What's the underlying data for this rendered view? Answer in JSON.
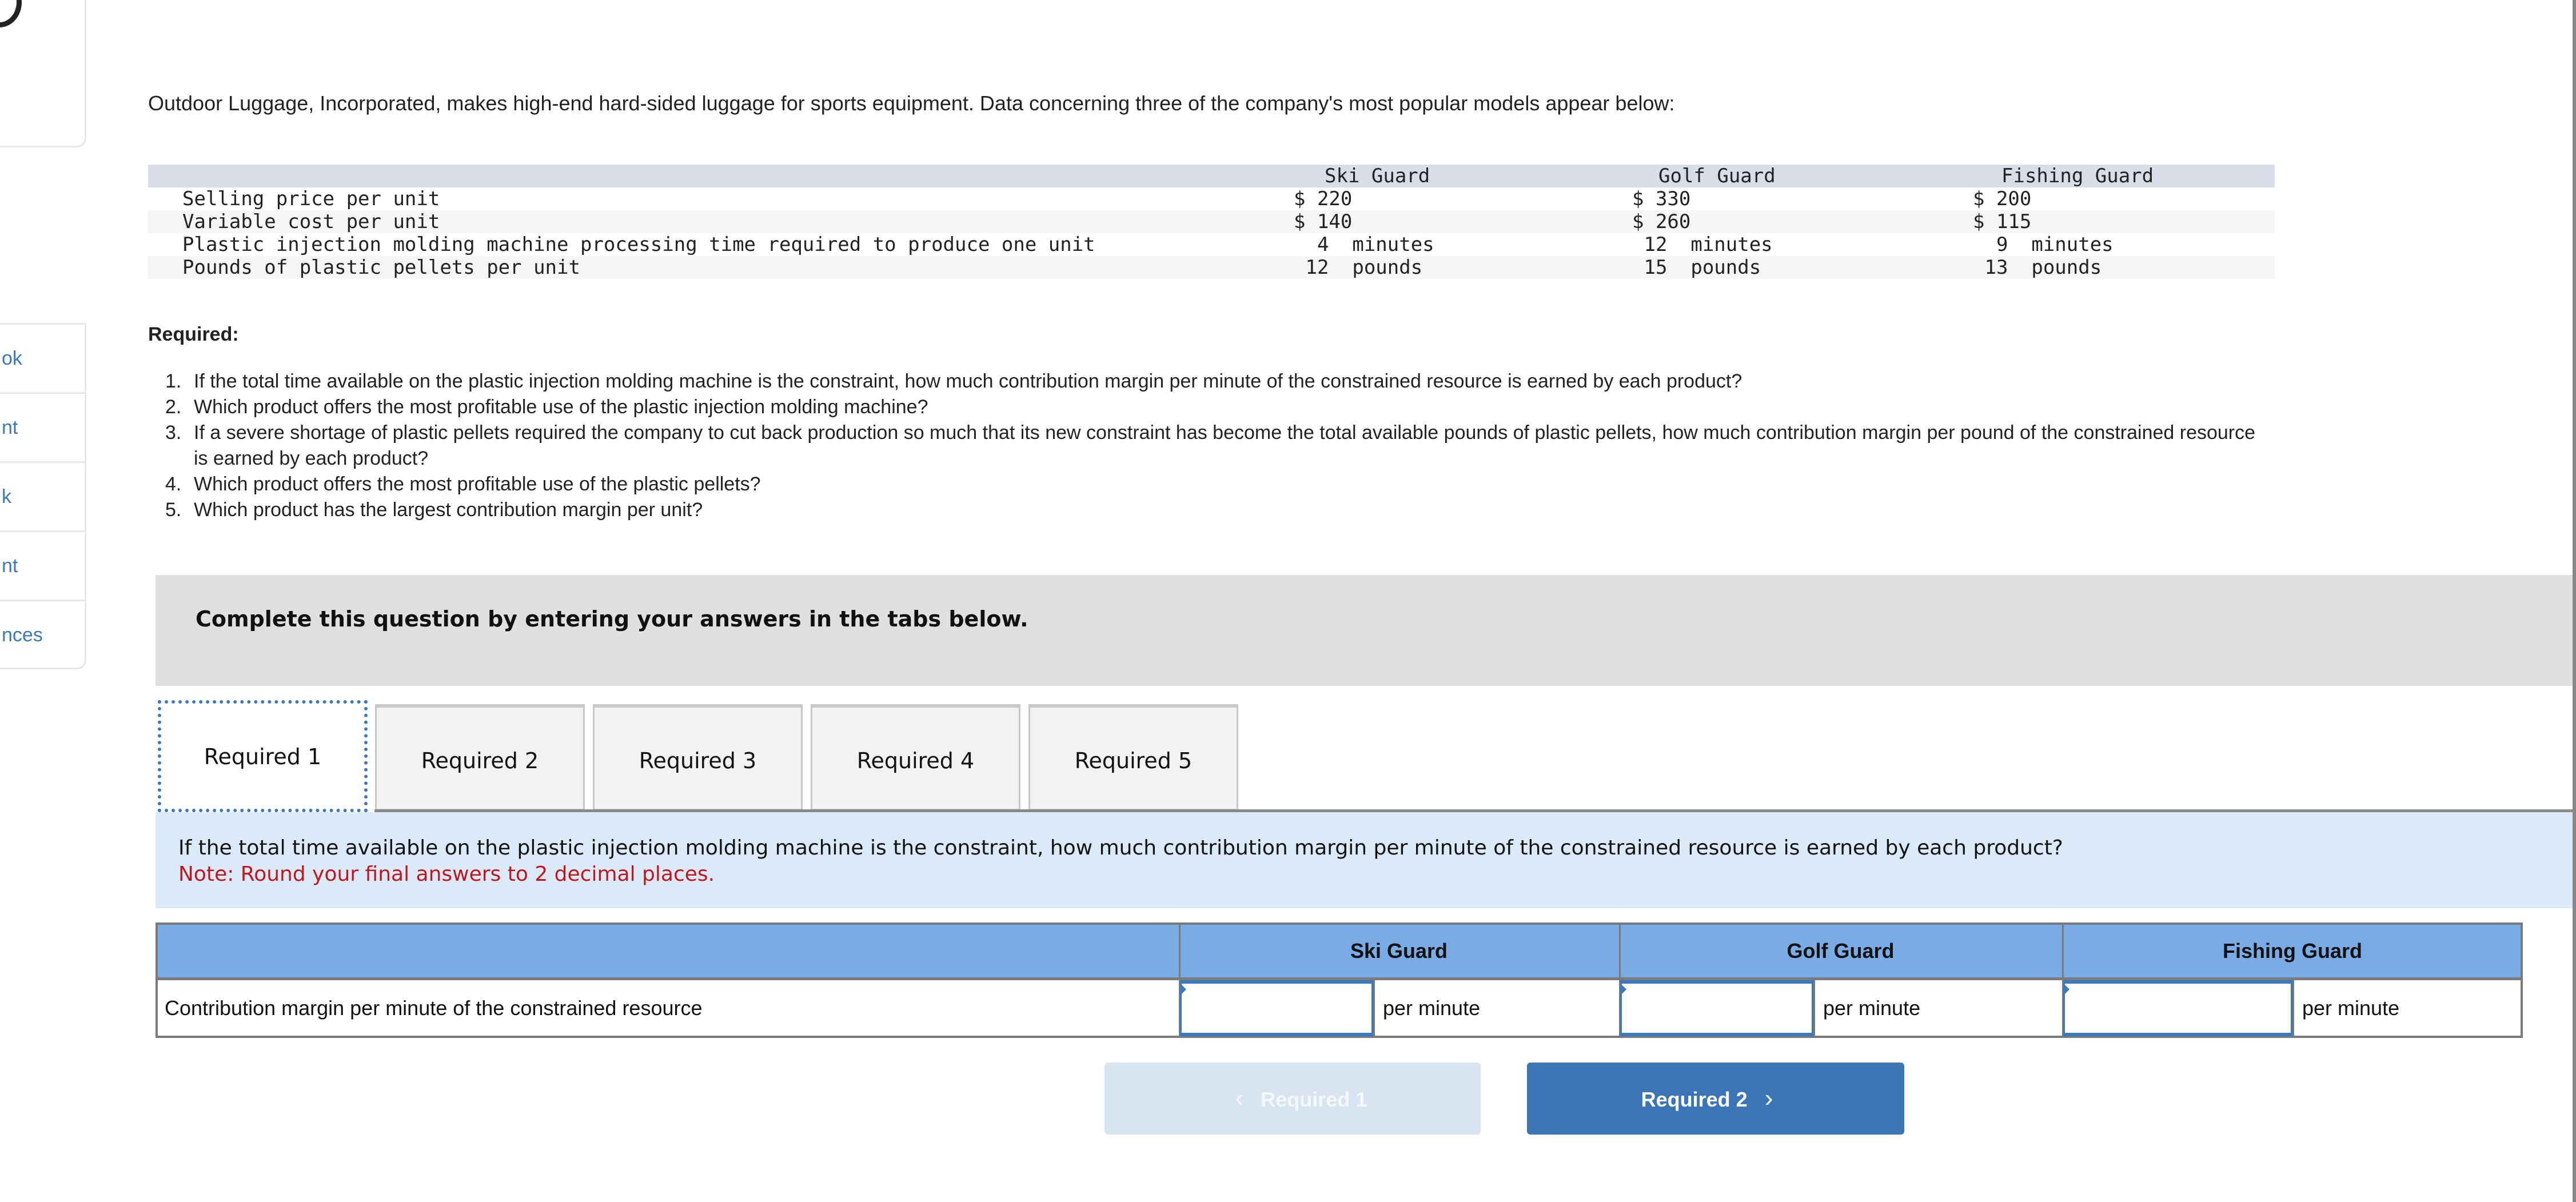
{
  "sidebar": {
    "items": [
      {
        "label": "ok"
      },
      {
        "label": "nt"
      },
      {
        "label": "k"
      },
      {
        "label": "nt"
      },
      {
        "label": "nces"
      }
    ]
  },
  "problem": {
    "intro": "Outdoor Luggage, Incorporated, makes high-end hard-sided luggage for sports equipment. Data concerning three of the company's most popular models appear below:",
    "table": {
      "columns": [
        "Ski Guard",
        "Golf Guard",
        "Fishing Guard"
      ],
      "rows": [
        {
          "label": "Selling price per unit",
          "values": [
            "$ 220",
            "$ 330",
            "$ 200"
          ]
        },
        {
          "label": "Variable cost per unit",
          "values": [
            "$ 140",
            "$ 260",
            "$ 115"
          ]
        },
        {
          "label": "Plastic injection molding machine processing time required to produce one unit",
          "values": [
            "  4  minutes",
            " 12  minutes",
            "  9  minutes"
          ]
        },
        {
          "label": "Pounds of plastic pellets per unit",
          "values": [
            " 12  pounds",
            " 15  pounds",
            " 13  pounds"
          ]
        }
      ]
    },
    "required_label": "Required:",
    "required": [
      {
        "num": "1.",
        "text": "If the total time available on the plastic injection molding machine is the constraint, how much contribution margin per minute of the constrained resource is earned by each product?"
      },
      {
        "num": "2.",
        "text": "Which product offers the most profitable use of the plastic injection molding machine?"
      },
      {
        "num": "3.",
        "text": "If a severe shortage of plastic pellets required the company to cut back production so much that its new constraint has become the total available pounds of plastic pellets, how much contribution margin per pound of the constrained resource is earned by each product?"
      },
      {
        "num": "4.",
        "text": "Which product offers the most profitable use of the plastic pellets?"
      },
      {
        "num": "5.",
        "text": "Which product has the largest contribution margin per unit?"
      }
    ]
  },
  "banner": {
    "text": "Complete this question by entering your answers in the tabs below."
  },
  "tabs": [
    {
      "label": "Required 1",
      "active": true
    },
    {
      "label": "Required 2"
    },
    {
      "label": "Required 3"
    },
    {
      "label": "Required 4"
    },
    {
      "label": "Required 5"
    }
  ],
  "question": {
    "text": "If the total time available on the plastic injection molding machine is the constraint, how much contribution margin per minute of the constrained resource is earned by each product?",
    "note": "Note: Round your final answers to 2 decimal places."
  },
  "answer_table": {
    "columns": [
      "Ski Guard",
      "Golf Guard",
      "Fishing Guard"
    ],
    "row_label": "Contribution margin per minute of the constrained resource",
    "inputs": [
      "",
      "",
      ""
    ],
    "unit": "per minute"
  },
  "nav": {
    "prev_label": "Required 1",
    "next_label": "Required 2",
    "prev_icon": "chevron-left-icon",
    "next_icon": "chevron-right-icon"
  },
  "colors": {
    "accent": "#3b75b8",
    "header_blue": "#79abe4",
    "question_bg": "#dbeaf8",
    "note_red": "#c0161c"
  }
}
